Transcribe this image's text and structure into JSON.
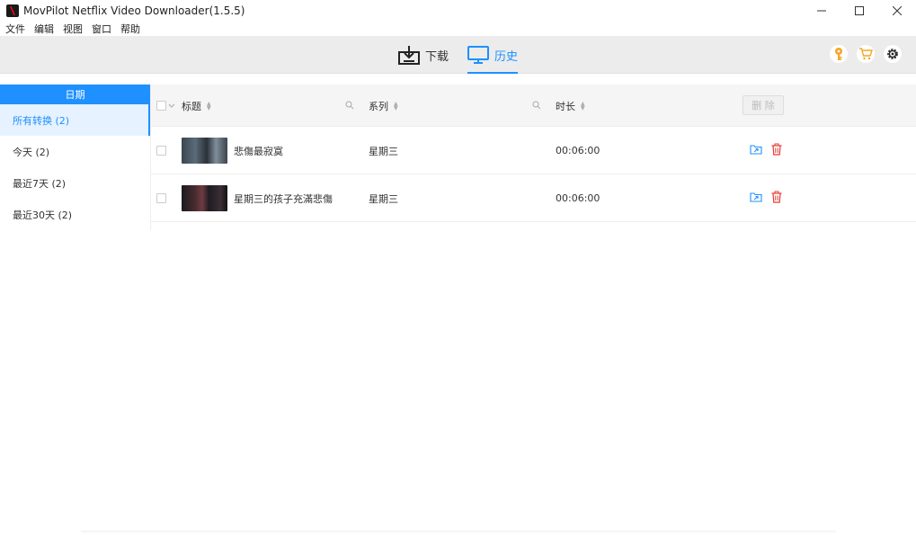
{
  "window": {
    "title": "MovPilot Netflix Video Downloader(1.5.5)",
    "controls": [
      "minimize-icon",
      "maximize-icon",
      "close-icon"
    ]
  },
  "menu": {
    "items": [
      "文件",
      "编辑",
      "视图",
      "窗口",
      "帮助"
    ]
  },
  "toolbar": {
    "tabs": [
      {
        "label": "下载",
        "icon": "download-icon",
        "active": false
      },
      {
        "label": "历史",
        "icon": "monitor-icon",
        "active": true
      }
    ],
    "icons": [
      "key-icon",
      "cart-icon",
      "gear-icon"
    ],
    "accent_color": "#1e90ff",
    "key_color": "#f5a623"
  },
  "sidebar": {
    "header": "日期",
    "items": [
      {
        "label": "所有转换 (2)",
        "active": true
      },
      {
        "label": "今天 (2)",
        "active": false
      },
      {
        "label": "最近7天 (2)",
        "active": false
      },
      {
        "label": "最近30天 (2)",
        "active": false
      }
    ]
  },
  "table": {
    "columns": {
      "title": "标题",
      "series": "系列",
      "duration": "时长"
    },
    "delete_label": "删 除",
    "rows": [
      {
        "title": "悲傷最寂寞",
        "series": "星期三",
        "duration": "00:06:00"
      },
      {
        "title": "星期三的孩子充滿悲傷",
        "series": "星期三",
        "duration": "00:06:00"
      }
    ],
    "row_actions": [
      "open-folder-icon",
      "trash-icon"
    ],
    "folder_color": "#1e90ff",
    "trash_color": "#e53935"
  }
}
